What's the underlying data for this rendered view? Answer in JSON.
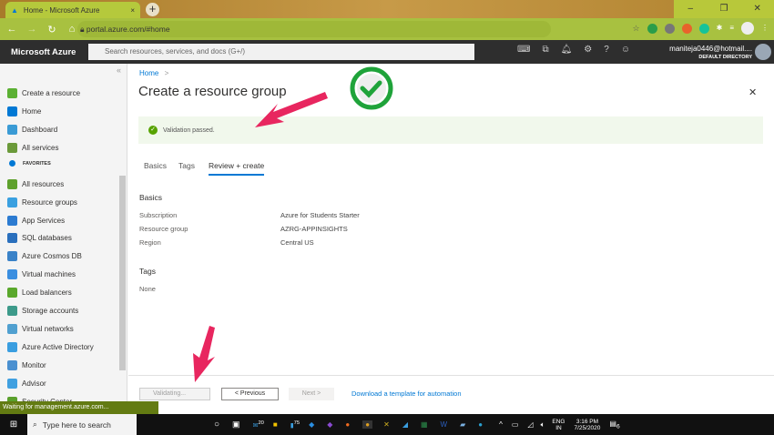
{
  "browser": {
    "tab_title": "Home - Microsoft Azure",
    "url": "portal.azure.com/#home",
    "tab_close": "×",
    "new_tab": "+",
    "window": {
      "min": "–",
      "max": "❐",
      "close": "✕"
    }
  },
  "header": {
    "brand": "Microsoft Azure",
    "search_placeholder": "Search resources, services, and docs (G+/)",
    "user": "maniteja0446@hotmail....",
    "directory": "DEFAULT DIRECTORY"
  },
  "sidebar": {
    "collapse": "«",
    "items": [
      {
        "label": "Create a resource",
        "color": "#5bb033"
      },
      {
        "label": "Home",
        "color": "#0078d4"
      },
      {
        "label": "Dashboard",
        "color": "#3a9bd5"
      },
      {
        "label": "All services",
        "color": "#6b9a3a"
      },
      {
        "label": "FAVORITES",
        "color": "#0078d4"
      },
      {
        "label": "All resources",
        "color": "#5ea12c"
      },
      {
        "label": "Resource groups",
        "color": "#3aa0e0"
      },
      {
        "label": "App Services",
        "color": "#2c7bd1"
      },
      {
        "label": "SQL databases",
        "color": "#2a6fbd"
      },
      {
        "label": "Azure Cosmos DB",
        "color": "#3a82c8"
      },
      {
        "label": "Virtual machines",
        "color": "#3a8ee0"
      },
      {
        "label": "Load balancers",
        "color": "#5aa82c"
      },
      {
        "label": "Storage accounts",
        "color": "#3d9a8a"
      },
      {
        "label": "Virtual networks",
        "color": "#50a0d0"
      },
      {
        "label": "Azure Active Directory",
        "color": "#3a9ee0"
      },
      {
        "label": "Monitor",
        "color": "#4a90d0"
      },
      {
        "label": "Advisor",
        "color": "#40a0e0"
      },
      {
        "label": "Security Center",
        "color": "#5aa02c"
      }
    ]
  },
  "main": {
    "breadcrumb": "Home",
    "breadcrumb_sep": ">",
    "title": "Create a resource group",
    "close": "✕",
    "banner": "Validation passed.",
    "tabs": [
      "Basics",
      "Tags",
      "Review + create"
    ],
    "basics_heading": "Basics",
    "rows": [
      {
        "label": "Subscription",
        "value": "Azure for Students Starter"
      },
      {
        "label": "Resource group",
        "value": "AZRG-APPINSIGHTS"
      },
      {
        "label": "Region",
        "value": "Central US"
      }
    ],
    "tags_heading": "Tags",
    "tags_value": "None",
    "footer": {
      "validating": "Validating...",
      "previous": "< Previous",
      "next": "Next >",
      "template_link": "Download a template for automation"
    }
  },
  "status_bar": "Waiting for management.azure.com...",
  "taskbar": {
    "search": "Type here to search",
    "lang": "ENG",
    "region": "IN",
    "time": "3:16 PM",
    "date": "7/25/2020",
    "badges": [
      "20",
      "75"
    ],
    "notifications": "6"
  }
}
